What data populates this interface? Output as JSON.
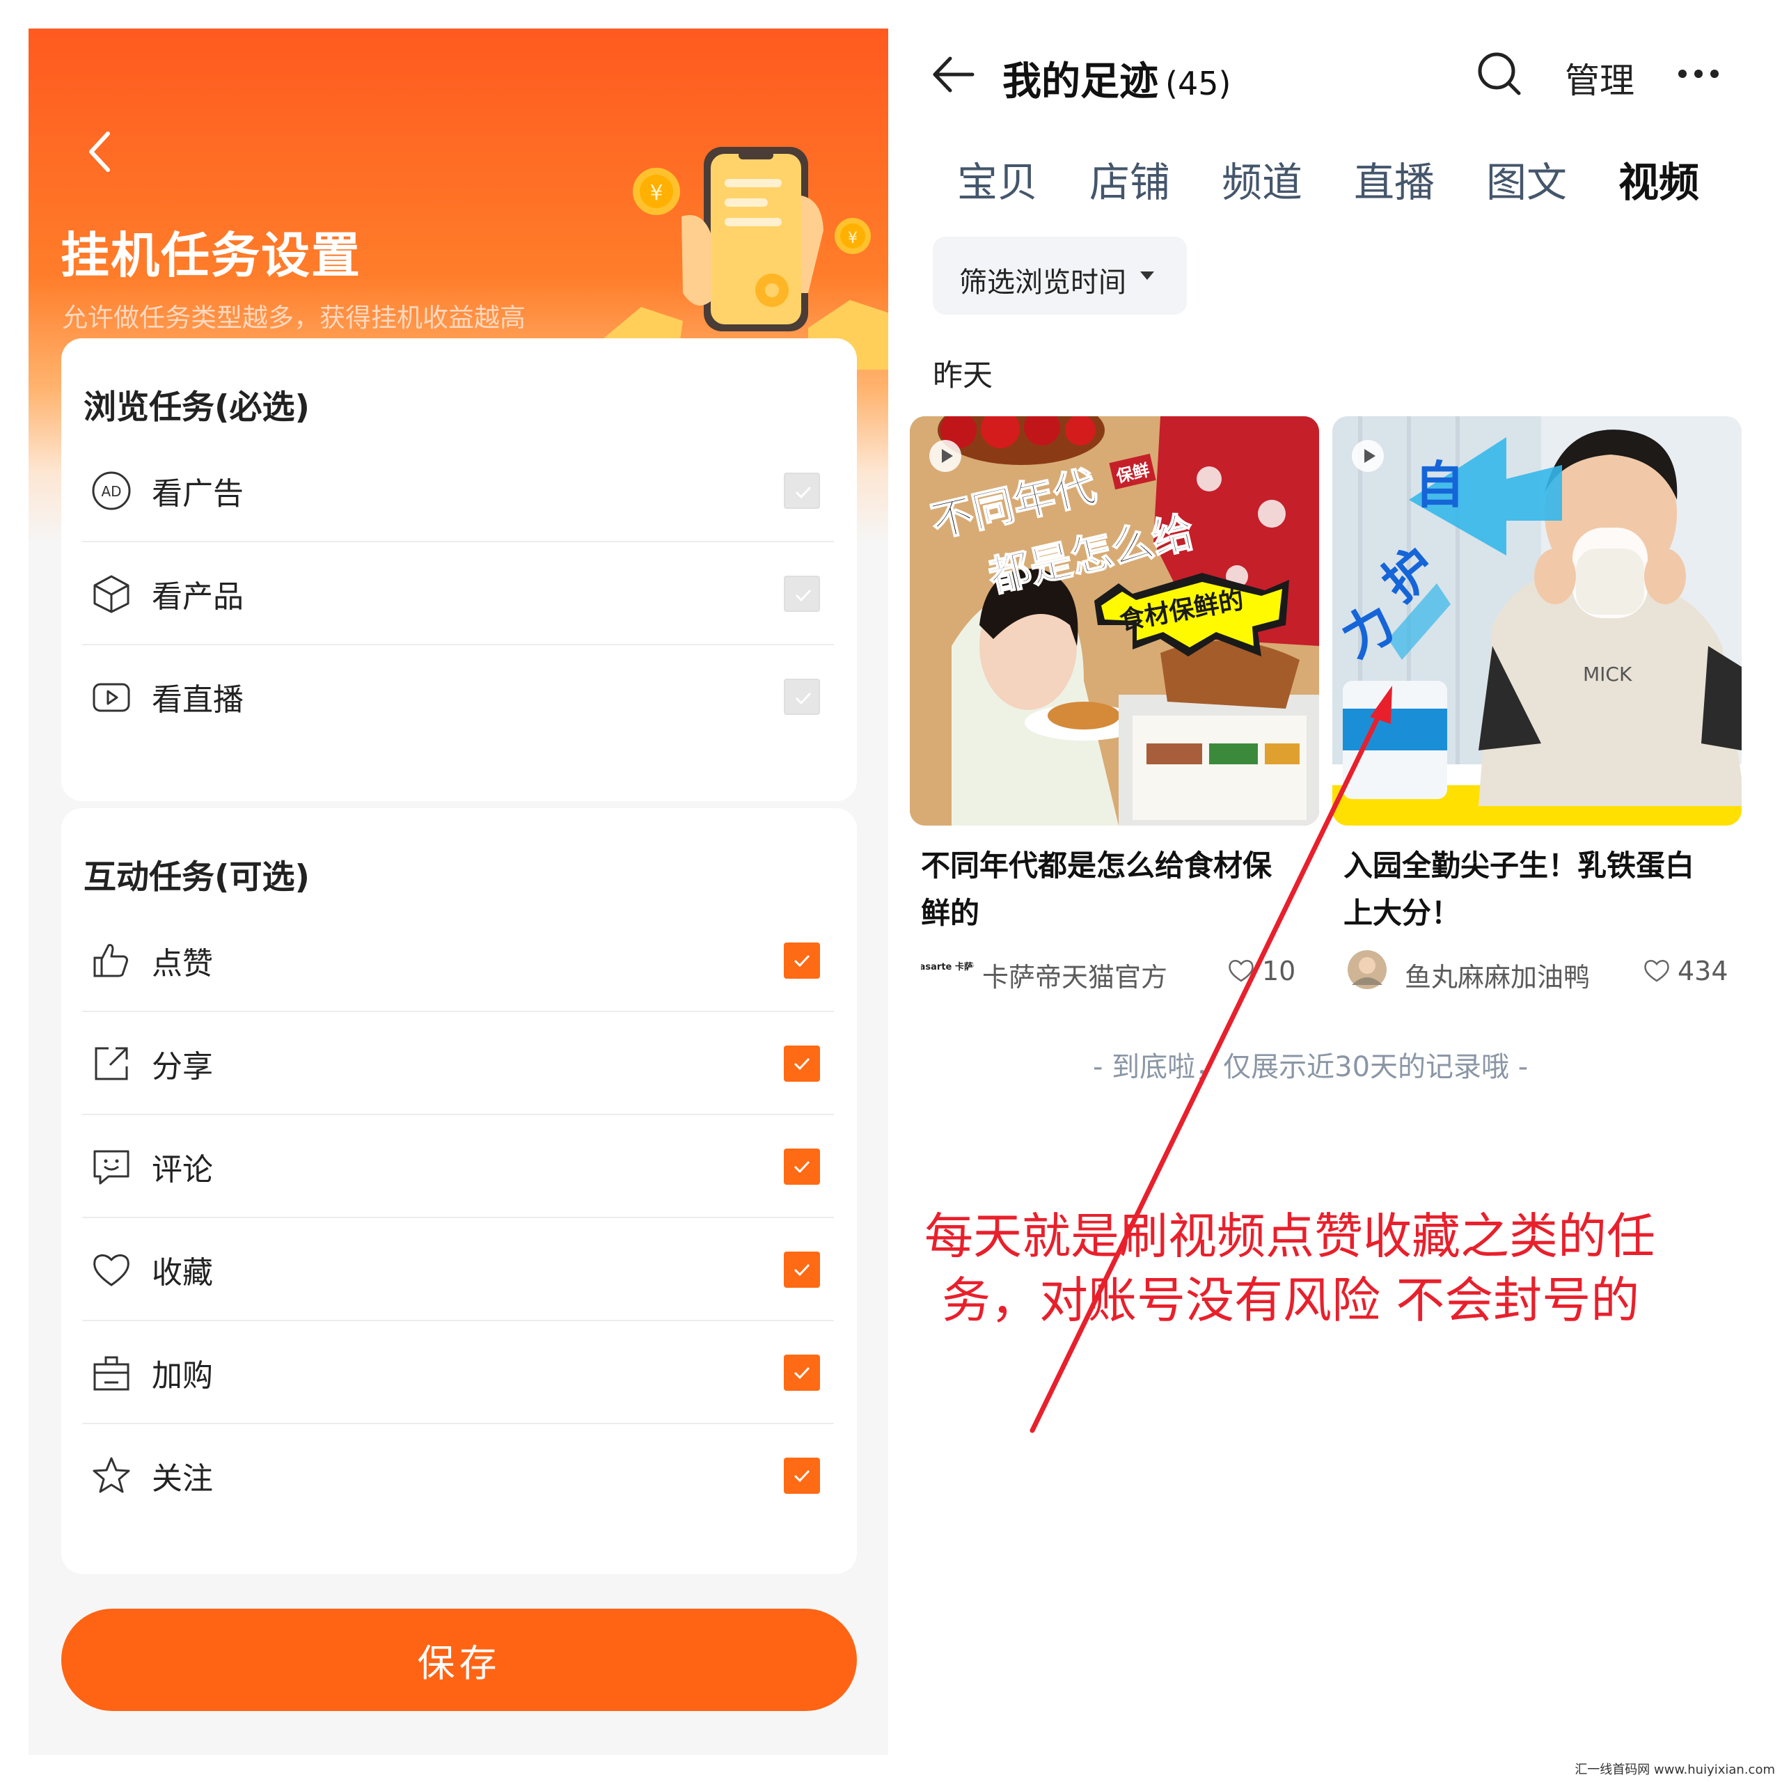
{
  "left": {
    "header": {
      "title": "挂机任务设置",
      "subtitle": "允许做任务类型越多，获得挂机收益越高"
    },
    "browse_section": {
      "title": "浏览任务(必选)",
      "items": [
        {
          "label": "看广告",
          "icon": "ad-icon",
          "checked": true,
          "disabled": true
        },
        {
          "label": "看产品",
          "icon": "product-box-icon",
          "checked": true,
          "disabled": true
        },
        {
          "label": "看直播",
          "icon": "play-icon",
          "checked": true,
          "disabled": true
        }
      ]
    },
    "interact_section": {
      "title": "互动任务(可选)",
      "items": [
        {
          "label": "点赞",
          "icon": "thumbs-up-icon",
          "checked": true
        },
        {
          "label": "分享",
          "icon": "share-icon",
          "checked": true
        },
        {
          "label": "评论",
          "icon": "comment-icon",
          "checked": true
        },
        {
          "label": "收藏",
          "icon": "heart-icon",
          "checked": true
        },
        {
          "label": "加购",
          "icon": "cart-bag-icon",
          "checked": true
        },
        {
          "label": "关注",
          "icon": "star-icon",
          "checked": true
        }
      ]
    },
    "save_label": "保存"
  },
  "right": {
    "header": {
      "title": "我的足迹",
      "count": "(45)",
      "manage_label": "管理"
    },
    "tabs": [
      "宝贝",
      "店铺",
      "频道",
      "直播",
      "图文",
      "视频"
    ],
    "active_tab": "视频",
    "filter_label": "筛选浏览时间",
    "section_date": "昨天",
    "videos": [
      {
        "title": "不同年代都是怎么给食材保鲜的",
        "author": "卡萨帝天猫官方",
        "author_logo": "Casarte 卡萨帝",
        "likes": "10",
        "thumb_text": [
          "不同年代",
          "都是怎么给",
          "食材保鲜的",
          "保鲜"
        ]
      },
      {
        "title": "入园全勤尖子生！乳铁蛋白上大分！",
        "author": "鱼丸麻麻加油鸭",
        "likes": "434",
        "thumb_text": [
          "自",
          "护",
          "力"
        ]
      }
    ],
    "end_note": "- 到底啦，仅展示近30天的记录哦 -"
  },
  "annotation": {
    "lines": [
      "每天就是刷视频点赞收藏之类的任",
      "务，对账号没有风险 不会封号的"
    ],
    "color": "#e8202c"
  },
  "watermark": "汇一线首码网 www.huiyixian.com",
  "colors": {
    "accent": "#ff6414",
    "checkbox_checked": "#ff6a14",
    "checkbox_disabled": "#e6e6e6"
  }
}
